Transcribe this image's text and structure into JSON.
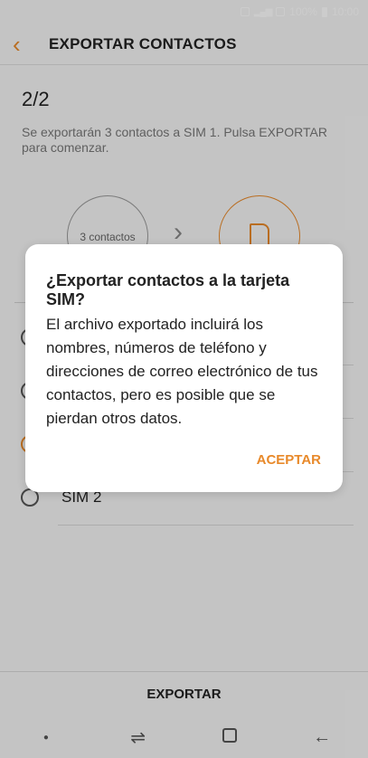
{
  "status_bar": {
    "battery": "100%",
    "time": "10:00"
  },
  "header": {
    "title": "EXPORTAR CONTACTOS"
  },
  "content": {
    "step": "2/2",
    "description": "Se exportarán 3 contactos a SIM 1. Pulsa EXPORTAR para comenzar.",
    "contacts_label": "3 contactos"
  },
  "options": [
    {
      "label": "",
      "selected": false
    },
    {
      "label": "",
      "selected": false
    },
    {
      "label": "",
      "selected": true
    },
    {
      "label": "SIM 2",
      "selected": false
    }
  ],
  "bottom": {
    "export_label": "EXPORTAR"
  },
  "dialog": {
    "title": "¿Exportar contactos a la tarjeta SIM?",
    "body": "El archivo exportado incluirá los nombres, números de teléfono y direcciones de correo electrónico de tus contactos, pero es posible que se pierdan otros datos.",
    "accept_label": "ACEPTAR"
  },
  "colors": {
    "accent": "#e8892a"
  },
  "icons": {
    "back": "back-chevron-icon",
    "arrow": "chevron-right-icon",
    "sim": "sim-card-icon",
    "nav_recent": "recent-apps-icon",
    "nav_home": "home-icon",
    "nav_back": "back-arrow-icon"
  }
}
